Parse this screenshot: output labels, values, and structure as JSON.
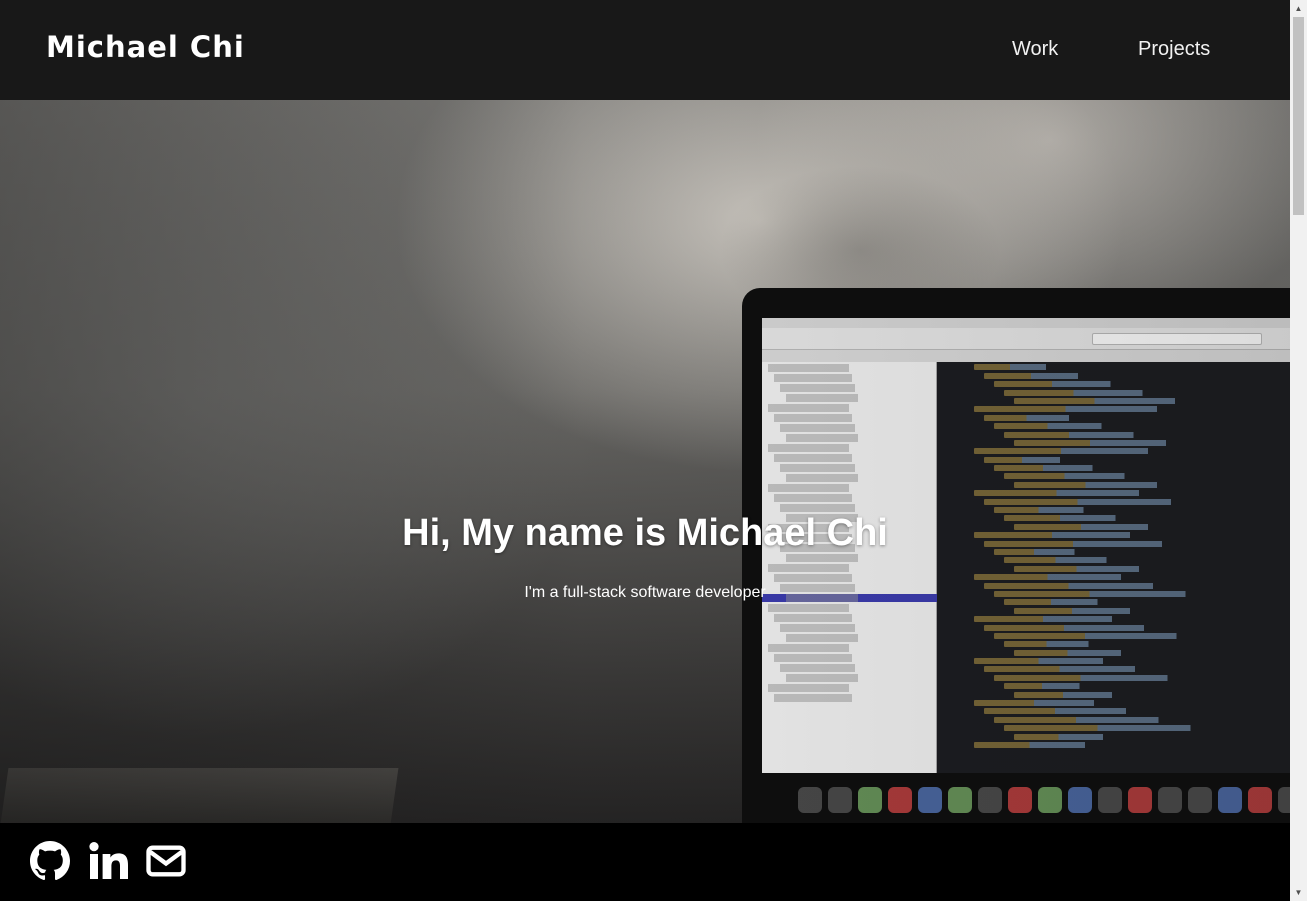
{
  "header": {
    "brand": "Michael Chi",
    "nav": [
      {
        "label": "Work"
      },
      {
        "label": "Projects"
      }
    ]
  },
  "hero": {
    "title": "Hi, My name is Michael Chi",
    "subtitle": "I'm a full-stack software developer"
  },
  "footer": {
    "social": [
      {
        "icon": "github-icon"
      },
      {
        "icon": "linkedin-icon"
      },
      {
        "icon": "envelope-icon"
      }
    ]
  },
  "colors": {
    "header_bg": "#181818",
    "footer_bg": "#000000",
    "text": "#ffffff"
  }
}
